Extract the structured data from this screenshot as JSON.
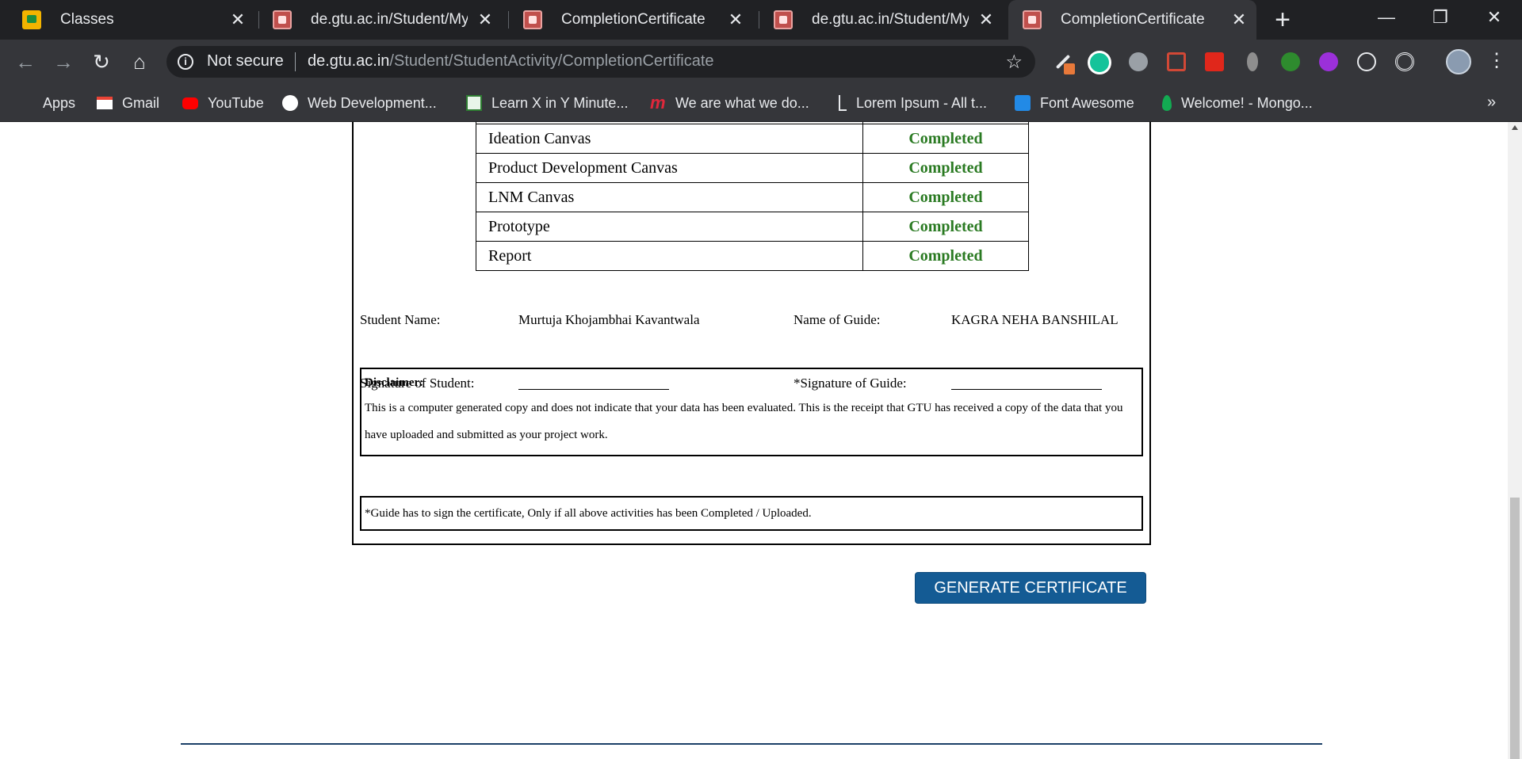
{
  "browser": {
    "tabs": [
      {
        "title": "Classes",
        "favicon": "classroom-icon",
        "active": false
      },
      {
        "title": "de.gtu.ac.in/Student/MyAcc",
        "favicon": "gtu-icon",
        "active": false
      },
      {
        "title": "CompletionCertificate",
        "favicon": "gtu-icon",
        "active": false
      },
      {
        "title": "de.gtu.ac.in/Student/MyAcc",
        "favicon": "gtu-icon",
        "active": false
      },
      {
        "title": "CompletionCertificate",
        "favicon": "gtu-icon",
        "active": true
      }
    ],
    "address": {
      "security_label": "Not secure",
      "host": "de.gtu.ac.in",
      "path": "/Student/StudentActivity/CompletionCertificate"
    },
    "bookmarks": [
      {
        "label": "Apps",
        "icon": "apps-grid-icon"
      },
      {
        "label": "Gmail",
        "icon": "gmail-icon"
      },
      {
        "label": "YouTube",
        "icon": "youtube-icon"
      },
      {
        "label": "Web Development...",
        "icon": "web-dev-icon"
      },
      {
        "label": "Learn X in Y Minute...",
        "icon": "learnx-icon"
      },
      {
        "label": "We are what we do...",
        "icon": "m-logo-icon"
      },
      {
        "label": "Lorem Ipsum - All t...",
        "icon": "lorem-icon"
      },
      {
        "label": "Font Awesome",
        "icon": "flag-icon"
      },
      {
        "label": "Welcome! - Mongo...",
        "icon": "mongodb-leaf-icon"
      }
    ]
  },
  "certificate": {
    "activities": [
      {
        "name": "Ideation Canvas",
        "status": "Completed"
      },
      {
        "name": "Product Development Canvas",
        "status": "Completed"
      },
      {
        "name": "LNM Canvas",
        "status": "Completed"
      },
      {
        "name": "Prototype",
        "status": "Completed"
      },
      {
        "name": "Report",
        "status": "Completed"
      }
    ],
    "student_name_label": "Student Name:",
    "student_name": "Murtuja Khojambhai Kavantwala",
    "guide_name_label": "Name of Guide:",
    "guide_name": "KAGRA NEHA BANSHILAL",
    "student_signature_label": "Signature of Student:",
    "guide_signature_label": "*Signature of Guide:",
    "disclaimer_heading": "Disclaimer:",
    "disclaimer_text": "This is a computer generated copy and does not indicate that your data has been evaluated. This is the receipt that GTU has received a copy of the data that you have uploaded and submitted as your project work.",
    "guide_note": "*Guide has to sign the certificate, Only if all above activities has been Completed / Uploaded."
  },
  "actions": {
    "generate_label": "GENERATE CERTIFICATE"
  },
  "colors": {
    "status_completed": "#2a7a22",
    "button_primary": "#145b94"
  }
}
